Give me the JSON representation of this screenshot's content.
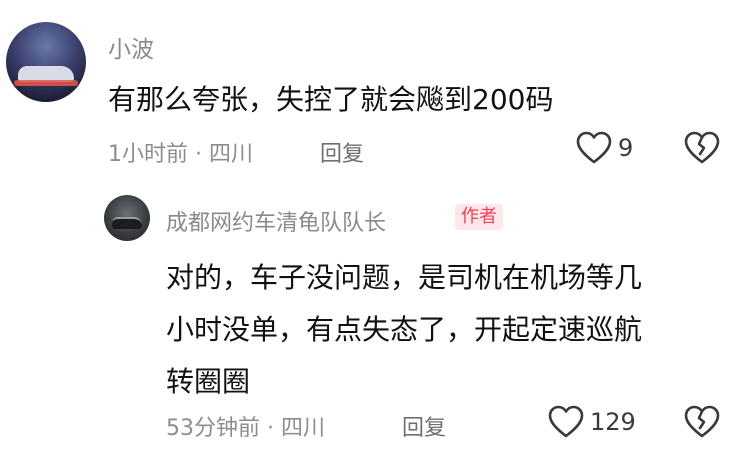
{
  "comment": {
    "user": "小波",
    "text": "有那么夸张，失控了就会飚到200码",
    "meta": "1小时前 · 四川",
    "reply_label": "回复",
    "likes": "9"
  },
  "reply": {
    "user": "成都网约车清龟队队长",
    "badge": "作者",
    "lines": [
      "对的，车子没问题，是司机在机场等几",
      "小时没单，有点失态了，开起定速巡航",
      "转圈圈"
    ],
    "meta": "53分钟前 · 四川",
    "reply_label": "回复",
    "likes": "129"
  },
  "colors": {
    "badge_text": "#f2415a",
    "badge_bg": "#fde7ea",
    "meta_text": "#8d8d8d"
  }
}
